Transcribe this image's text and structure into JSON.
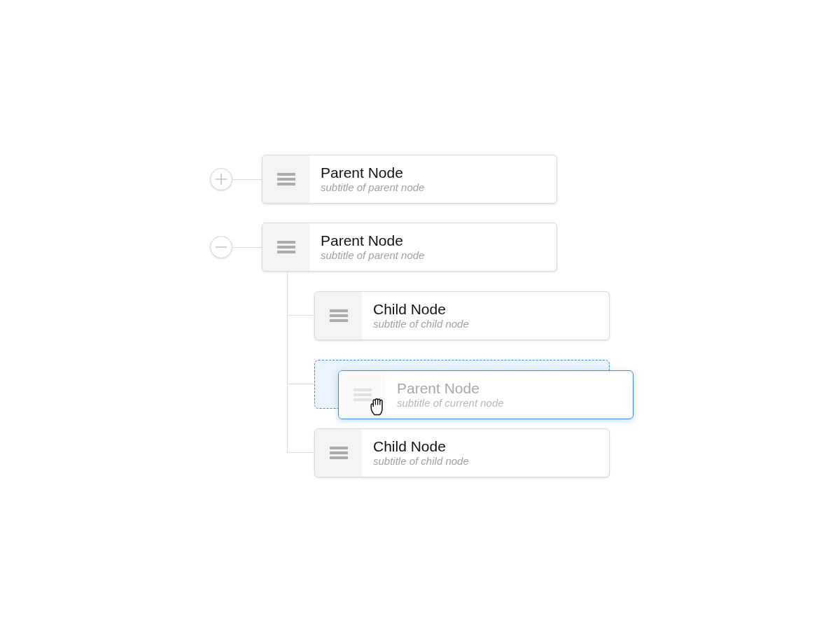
{
  "tree": {
    "nodes": [
      {
        "title": "Parent Node",
        "subtitle": "subtitle of parent node",
        "expanded": false
      },
      {
        "title": "Parent Node",
        "subtitle": "subtitle of parent node",
        "expanded": true,
        "children": [
          {
            "kind": "node",
            "title": "Child Node",
            "subtitle": "subtitle of child node"
          },
          {
            "kind": "drop_target",
            "dragged": {
              "title": "Parent Node",
              "subtitle": "subtitle of current node"
            }
          },
          {
            "kind": "node",
            "title": "Child Node",
            "subtitle": "subtitle of child node"
          }
        ]
      }
    ]
  }
}
